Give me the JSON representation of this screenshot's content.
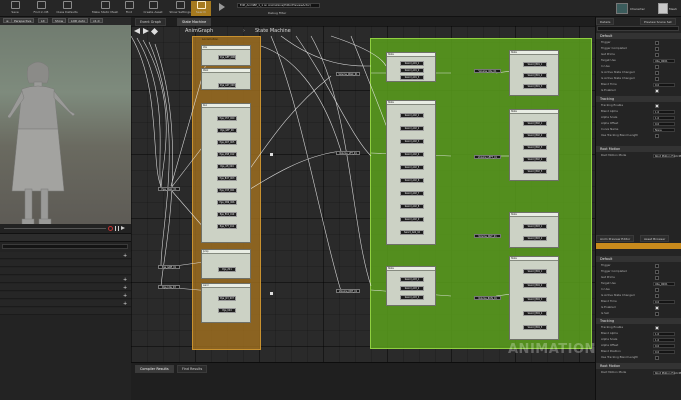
{
  "toolbar": {
    "buttons": [
      "Save",
      "Find in CB",
      "Class Defaults",
      "Preview Inline",
      "Make Static Mesh",
      "Find",
      "Create Asset",
      "Show Settings",
      "Search",
      "Play"
    ],
    "breadcrumb_path": "Edit_AnimBP_1_1 on Animations(EditorPreviewActor)",
    "debug_filter": "Debug Filter",
    "right_label_1": "Character",
    "right_label_2": "Mesh"
  },
  "viewport": {
    "chips": [
      "Perspective",
      "Lit",
      "Show",
      "LOD Auto",
      "x1.0"
    ]
  },
  "tabs": {
    "graph": [
      "Event Graph",
      "State Machine"
    ],
    "breadcrumbs": [
      "AnimGraph",
      "State Machine"
    ],
    "bottom": [
      "Compiler Results",
      "Find Results"
    ]
  },
  "graph": {
    "watermark": "ANIMATION",
    "state_machine_label": "Locomotion",
    "pills_left": [
      "Pga_Walk_01",
      "Pga_GRE_01",
      "Pga_Idle_03"
    ],
    "pills_middle": [
      "Volume_Walk_01",
      "Volume_LFT_01",
      "Volume_DRT_01"
    ],
    "pills_right": [
      "Volume_Idle_01",
      "Volume_LEFT_01",
      "Volume_RGT_01",
      "Volume_RUN_01"
    ],
    "orange_states": [
      {
        "title": "Idle",
        "rows": [
          "Pga_GEF_008"
        ]
      },
      {
        "title": "Walk",
        "rows": [
          "Pga_A47_000"
        ]
      },
      {
        "title": "Run",
        "rows": [
          "Pga_C57_000",
          "Pga_GEF_09",
          "Pga_A67_005",
          "Pga_A58_012",
          "Pga_A8_004",
          "Pga_B47_003",
          "Pga_C33_001",
          "Pga_D99_006",
          "Pga_E12_010",
          "Pga_F77_011"
        ]
      },
      {
        "title": "Jump",
        "rows": [
          "Pga_Z21"
        ]
      },
      {
        "title": "Land",
        "rows": [
          "Pga_J13_007",
          "Pga_K44"
        ]
      }
    ],
    "green_states": [
      {
        "title": "State",
        "rows": [
          "Sword_A01_1",
          "Sword_A01_2",
          "Sword_A01_3"
        ]
      },
      {
        "title": "State",
        "rows": [
          "Sword_A02_1",
          "Sword_A02_2",
          "Sword_A02_3",
          "Sword_A02_4",
          "Sword_A02_5",
          "Sword_A02_6",
          "Sword_A02_7",
          "Sword_A02_8",
          "Sword_A02_9",
          "Sword_A02_10"
        ]
      },
      {
        "title": "State",
        "rows": [
          "Sword_A03_1",
          "Sword_A03_2",
          "Sword_A03_3"
        ]
      },
      {
        "title": "State",
        "rows": [
          "Sword_B01_1",
          "Sword_B01_2",
          "Sword_B01_3"
        ]
      },
      {
        "title": "State",
        "rows": [
          "Sword_B02_1",
          "Sword_B02_2",
          "Sword_B02_3",
          "Sword_B02_4",
          "Sword_B02_5"
        ]
      },
      {
        "title": "State",
        "rows": [
          "Sword_B03_1",
          "Sword_B03_2"
        ]
      },
      {
        "title": "State",
        "rows": [
          "Sword_B04_1",
          "Sword_B04_2",
          "Sword_B04_3",
          "Sword_B04_4",
          "Sword_B04_5"
        ]
      }
    ]
  },
  "right_panel": {
    "tabs_top": [
      "Details",
      "Preview Scene Set"
    ],
    "tabs_mid": [
      "Anim Preview Editor",
      "Asset Browser"
    ],
    "sections_top": [
      "Default",
      "Tracking",
      "Root Motion"
    ],
    "sections_bottom": [
      "Default",
      "Tracking",
      "Root Motion"
    ],
    "rows_top": [
      "Trigger",
      "Trigger Completed",
      "Get Prime",
      "Target Use",
      "In Use",
      "Is Active State Changed",
      "Is Active State Changed",
      "Blend Time",
      "Is Enabled"
    ],
    "rows_top_values": [
      "",
      "",
      "",
      "Idle_0001",
      "",
      "",
      "",
      "0.0",
      ""
    ],
    "rows_tracking": [
      "Tracking Enable",
      "Blend Alpha",
      "Alpha Scale",
      "Alpha Offset",
      "Curve Name",
      "Use Tracking Blend Length"
    ],
    "rows_tracking_values": [
      "",
      "1.0",
      "1.0",
      "0.0",
      "None",
      ""
    ],
    "root_motion_row": "Root Motion Mode",
    "root_motion_value": "Root Motion From Montage",
    "rows_bottom": [
      "Trigger",
      "Trigger Completed",
      "Get Prime",
      "Target Use",
      "In Use",
      "Is Active State Changed",
      "Blend Time",
      "Is Enabled",
      "Is Set"
    ],
    "rows_bottom_values": [
      "",
      "",
      "",
      "Idle_0001",
      "",
      "",
      "0.0",
      "",
      ""
    ],
    "rows_tracking_b": [
      "Tracking Enable",
      "Blend Alpha",
      "Alpha Scale",
      "Alpha Offset",
      "Blend Position",
      "Use Tracking Blend Length"
    ],
    "rows_tracking_b_values": [
      "",
      "1.0",
      "1.0",
      "0.0",
      "0.0",
      ""
    ]
  },
  "colors": {
    "orange_sm": "#a6731f",
    "green_sm": "#5aa01c",
    "accent": "#d49b2e"
  }
}
